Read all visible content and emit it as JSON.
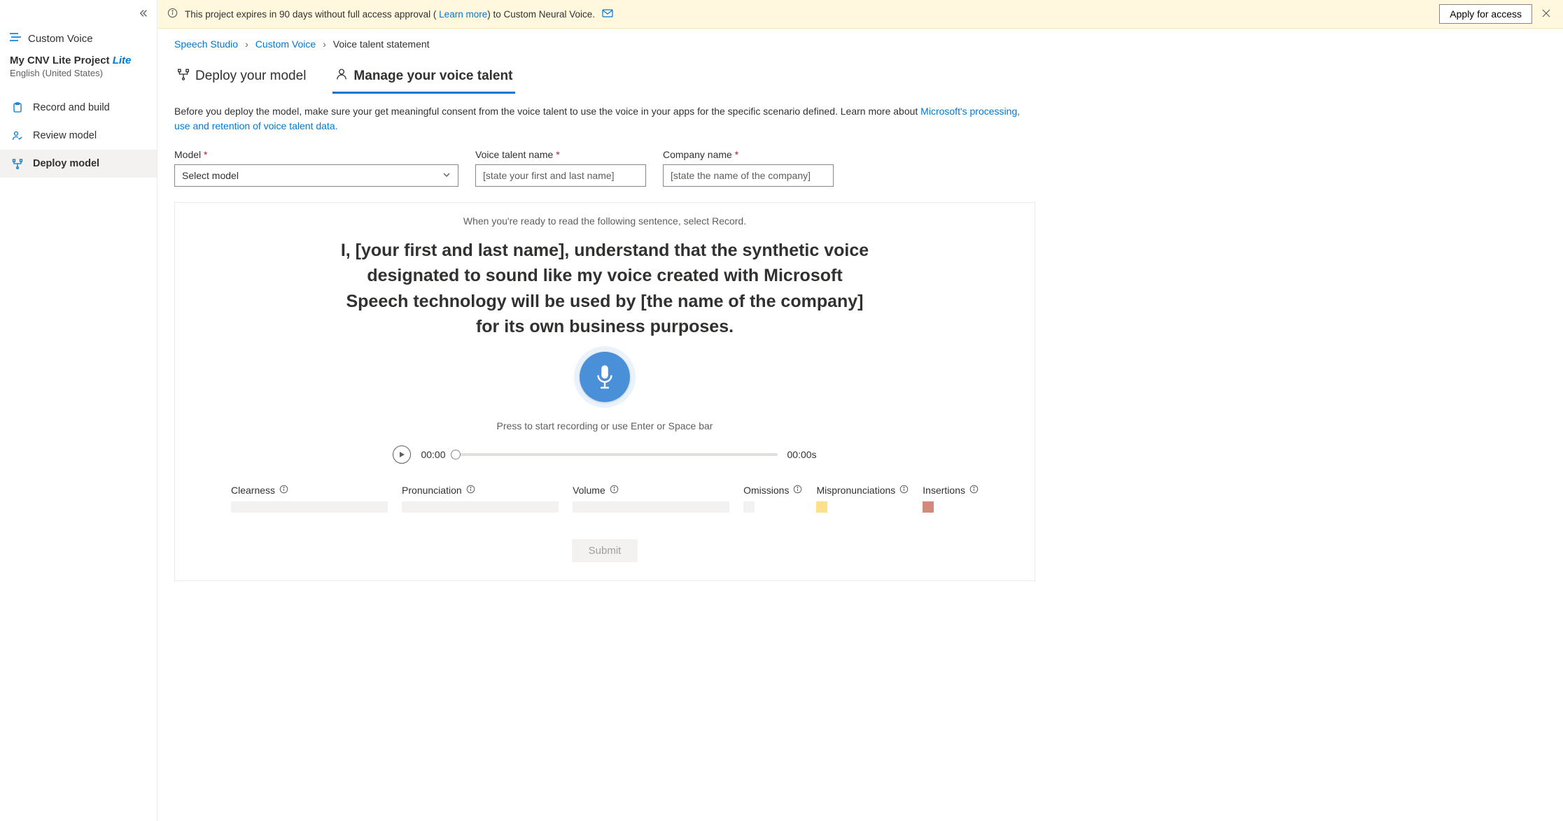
{
  "sidebar": {
    "app_label": "Custom Voice",
    "project_name": "My CNV Lite Project",
    "project_badge": "Lite",
    "project_lang": "English (United States)",
    "nav": [
      {
        "label": "Record and build"
      },
      {
        "label": "Review model"
      },
      {
        "label": "Deploy model"
      }
    ]
  },
  "banner": {
    "text_before": "This project expires in 90 days without full access approval ( ",
    "learn_more": "Learn more",
    "text_after": ") to Custom Neural Voice.",
    "apply": "Apply for access"
  },
  "crumbs": {
    "a": "Speech Studio",
    "b": "Custom Voice",
    "c": "Voice talent statement"
  },
  "tabs": {
    "deploy": "Deploy your model",
    "manage": "Manage your voice talent"
  },
  "desc": {
    "text": "Before you deploy the model, make sure your get meaningful consent from the voice talent to use the voice in your apps for the specific scenario defined. Learn more about ",
    "link": "Microsoft's processing, use and retention of voice talent data."
  },
  "form": {
    "model_label": "Model",
    "model_placeholder": "Select model",
    "talent_label": "Voice talent name",
    "talent_placeholder": "[state your first and last name]",
    "company_label": "Company name",
    "company_placeholder": "[state the name of the company]"
  },
  "panel": {
    "hint": "When you're ready to read the following sentence, select Record.",
    "statement": "I, [your first and last name], understand that the synthetic voice designated to sound like my voice created with Microsoft Speech technology will be used by [the name of the company] for its own business purposes.",
    "rec_hint": "Press to start recording or use Enter or Space bar",
    "time_start": "00:00",
    "time_end": "00:00s",
    "metrics": {
      "clearness": "Clearness",
      "pronunciation": "Pronunciation",
      "volume": "Volume",
      "omissions": "Omissions",
      "mispronunciations": "Mispronunciations",
      "insertions": "Insertions"
    },
    "submit": "Submit"
  }
}
